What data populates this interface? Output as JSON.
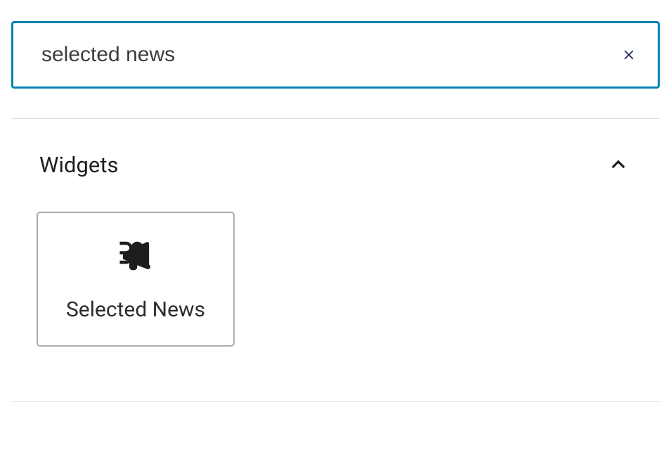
{
  "search": {
    "value": "selected news",
    "placeholder": ""
  },
  "section": {
    "title": "Widgets"
  },
  "widgets": [
    {
      "label": "Selected News",
      "icon": "megaphone"
    }
  ]
}
